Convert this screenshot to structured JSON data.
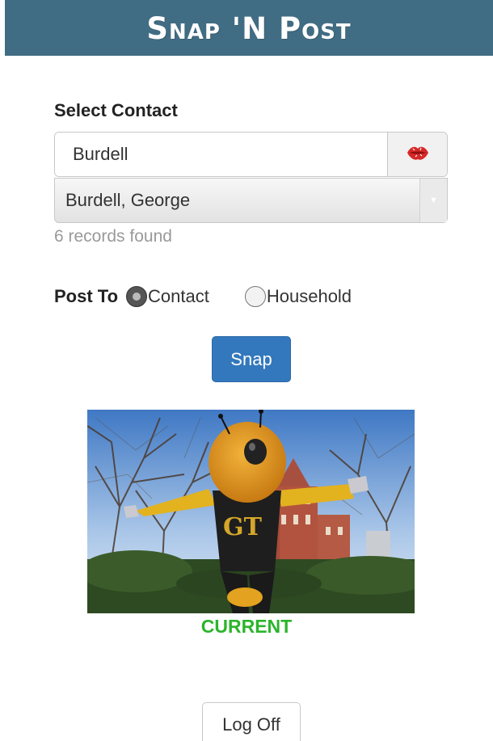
{
  "app": {
    "title": "Snap 'N Post",
    "header_color": "#416d84"
  },
  "contact": {
    "label": "Select Contact",
    "search_value": "Burdell",
    "clear_icon": "lips-icon",
    "selected": "Burdell, George",
    "records_text": "6 records found"
  },
  "post_to": {
    "label": "Post To",
    "options": [
      {
        "label": "Contact",
        "checked": true
      },
      {
        "label": "Household",
        "checked": false
      }
    ]
  },
  "actions": {
    "snap_label": "Snap",
    "snap_color": "#3378bc",
    "logoff_label": "Log Off"
  },
  "photo": {
    "status": "CURRENT",
    "status_color": "#2bb52b"
  }
}
